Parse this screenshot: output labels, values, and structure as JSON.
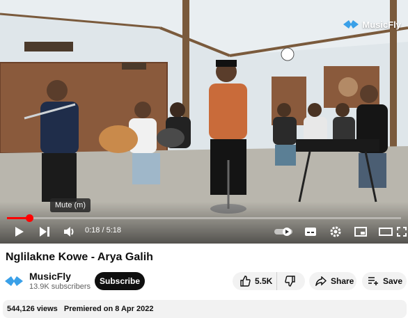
{
  "player": {
    "watermark": "MusicFly",
    "tooltip": "Mute (m)",
    "current_time": "0:18",
    "duration": "5:18",
    "time_separator": " / ",
    "progress_fraction": 0.057,
    "icons": [
      "play-icon",
      "next-icon",
      "volume-icon",
      "autoplay-toggle-icon",
      "subtitles-icon",
      "settings-icon",
      "miniplayer-icon",
      "theater-icon",
      "fullscreen-icon"
    ]
  },
  "video": {
    "title": "Nglilakne Kowe - Arya Galih"
  },
  "channel": {
    "name": "MusicFly",
    "subscribers": "13.9K subscribers",
    "subscribe_label": "Subscribe"
  },
  "actions": {
    "likes": "5.5K",
    "share_label": "Share",
    "save_label": "Save"
  },
  "description": {
    "views": "544,126 views",
    "premiered": "Premiered on 8 Apr 2022"
  },
  "colors": {
    "progress": "#ff0000",
    "subscribe_bg": "#0f0f0f",
    "pill_bg": "#f2f2f2",
    "watermark_logo": "#3aa0e8"
  }
}
